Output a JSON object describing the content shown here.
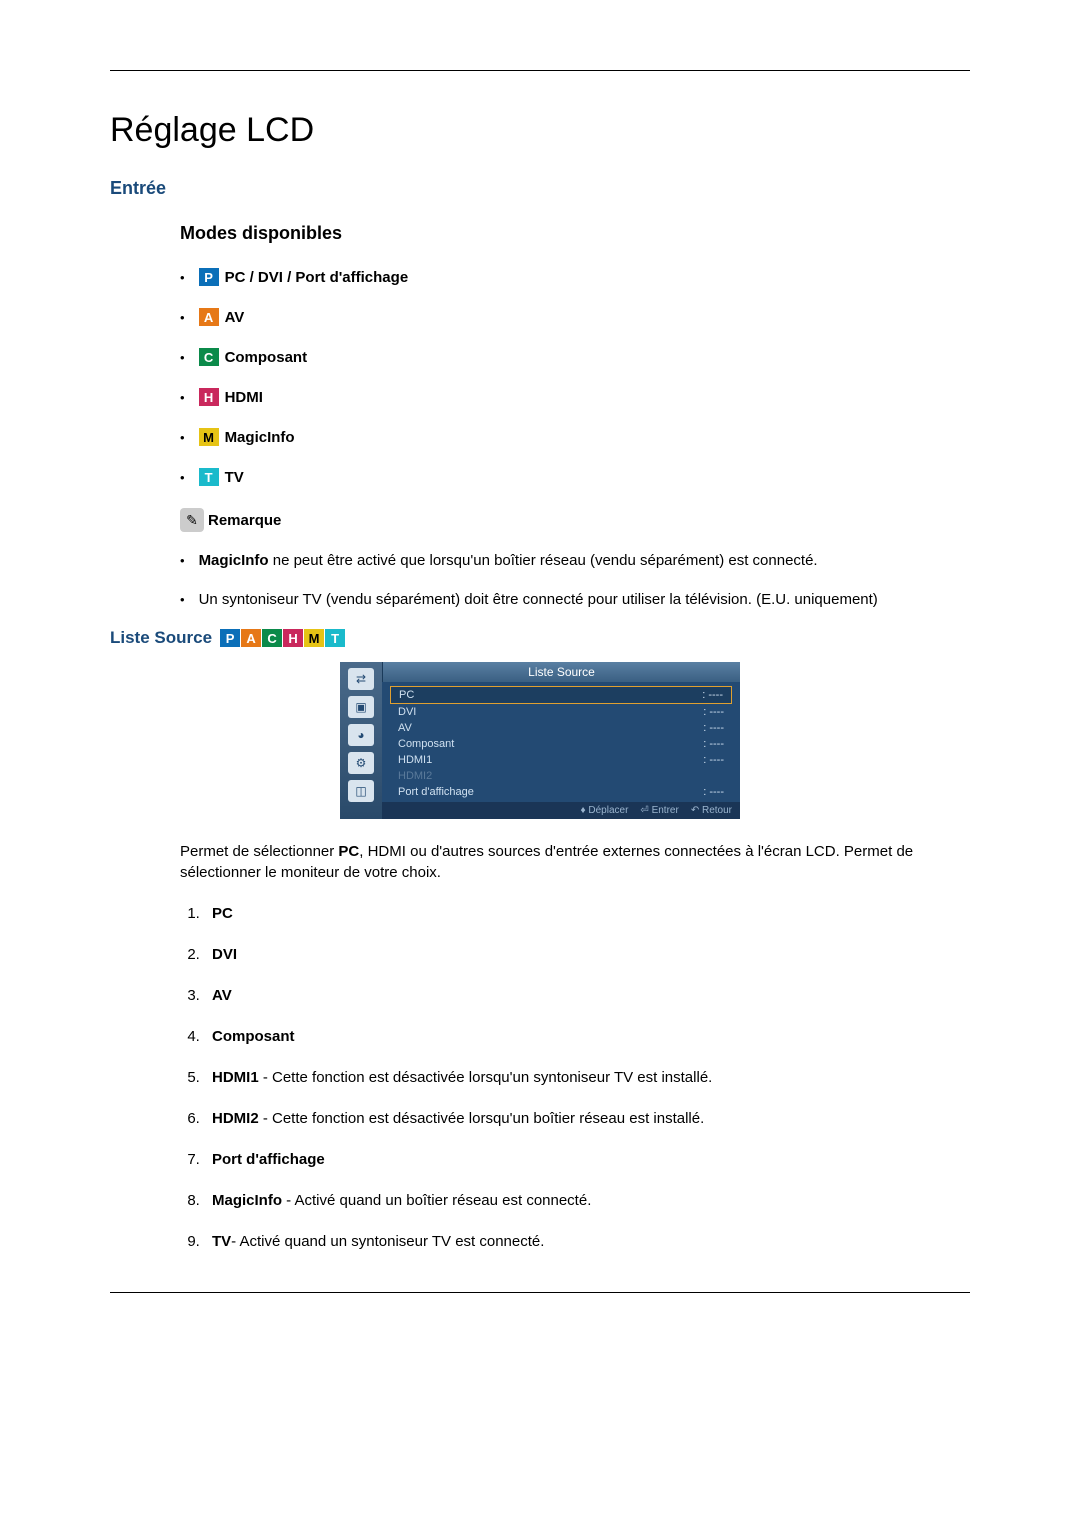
{
  "title": "Réglage LCD",
  "section_entree": "Entrée",
  "subsection_modes": "Modes disponibles",
  "modes": {
    "pc": {
      "letter": "P",
      "label": "PC / DVI / Port d'affichage"
    },
    "av": {
      "letter": "A",
      "label": "AV"
    },
    "comp": {
      "letter": "C",
      "label": "Composant"
    },
    "hdmi": {
      "letter": "H",
      "label": "HDMI"
    },
    "magic": {
      "letter": "M",
      "label": "MagicInfo"
    },
    "tv": {
      "letter": "T",
      "label": "TV"
    }
  },
  "note_label": "Remarque",
  "remarks": {
    "r1_bold": "MagicInfo",
    "r1_rest": " ne peut être activé que lorsqu'un boîtier réseau (vendu séparément) est connecté.",
    "r2": "Un syntoniseur TV (vendu séparément) doit être connecté pour utiliser la télévision. (E.U. uniquement)"
  },
  "liste_source_label": "Liste Source",
  "osd": {
    "title": "Liste Source",
    "rows": [
      {
        "name": "PC",
        "val": ": ----",
        "sel": true
      },
      {
        "name": "DVI",
        "val": ": ----"
      },
      {
        "name": "AV",
        "val": ": ----"
      },
      {
        "name": "Composant",
        "val": ": ----"
      },
      {
        "name": "HDMI1",
        "val": ": ----"
      },
      {
        "name": "HDMI2",
        "val": "",
        "dis": true
      },
      {
        "name": "Port d'affichage",
        "val": ": ----"
      }
    ],
    "foot": {
      "move": "Déplacer",
      "enter": "Entrer",
      "return": "Retour"
    }
  },
  "post_para_pre": "Permet de sélectionner ",
  "post_para_bold": "PC",
  "post_para_rest": ", HDMI ou d'autres sources d'entrée externes connectées à l'écran LCD. Permet de sélectionner le moniteur de votre choix.",
  "sources": {
    "s1": "PC",
    "s2": "DVI",
    "s3": "AV",
    "s4": "Composant",
    "s5_b": "HDMI1",
    "s5_r": " - Cette fonction est désactivée lorsqu'un syntoniseur TV est installé.",
    "s6_b": "HDMI2",
    "s6_r": " - Cette fonction est désactivée lorsqu'un boîtier réseau est installé.",
    "s7": "Port d'affichage",
    "s8_b": "MagicInfo",
    "s8_r": " - Activé quand un boîtier réseau est connecté.",
    "s9_b": "TV",
    "s9_r": "- Activé quand un syntoniseur TV est connecté."
  }
}
